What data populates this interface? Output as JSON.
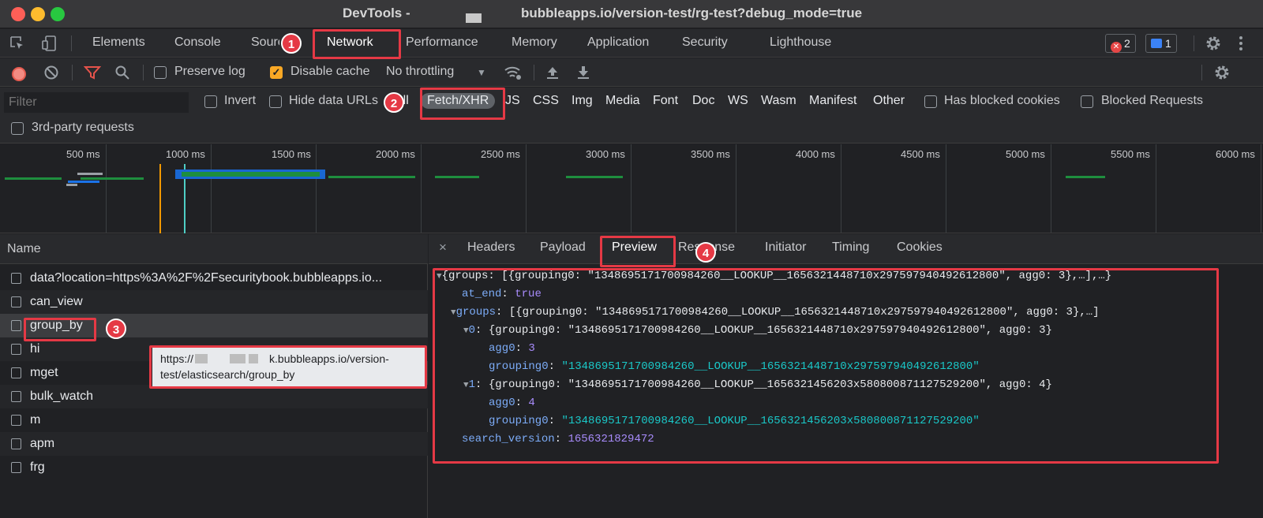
{
  "window": {
    "title_left": "DevTools -",
    "title_right": "bubbleapps.io/version-test/rg-test?debug_mode=true"
  },
  "main_tabs": [
    "Elements",
    "Console",
    "Sources",
    "Network",
    "Performance",
    "Memory",
    "Application",
    "Security",
    "Lighthouse"
  ],
  "status": {
    "errors": "2",
    "messages": "1"
  },
  "toolbar": {
    "preserve_log": "Preserve log",
    "disable_cache": "Disable cache",
    "throttling": "No throttling"
  },
  "filterbar": {
    "filter_placeholder": "Filter",
    "invert": "Invert",
    "hide_data_urls": "Hide data URLs",
    "all": "All",
    "types": [
      "Fetch/XHR",
      "JS",
      "CSS",
      "Img",
      "Media",
      "Font",
      "Doc",
      "WS",
      "Wasm",
      "Manifest",
      "Other"
    ],
    "has_blocked_cookies": "Has blocked cookies",
    "blocked_requests": "Blocked Requests",
    "third_party": "3rd-party requests"
  },
  "overview_ticks": [
    "500 ms",
    "1000 ms",
    "1500 ms",
    "2000 ms",
    "2500 ms",
    "3000 ms",
    "3500 ms",
    "4000 ms",
    "4500 ms",
    "5000 ms",
    "5500 ms",
    "6000 ms"
  ],
  "requests": {
    "header": "Name",
    "items": [
      "data?location=https%3A%2F%2Fsecuritybook.bubbleapps.io...",
      "can_view",
      "group_by",
      "hi",
      "mget",
      "bulk_watch",
      "m",
      "apm",
      "frg"
    ]
  },
  "tooltip": {
    "line1_prefix": "https://",
    "line1_suffix": "k.bubbleapps.io/version-",
    "line2": "test/elasticsearch/group_by"
  },
  "detail_tabs": [
    "Headers",
    "Payload",
    "Preview",
    "Response",
    "Initiator",
    "Timing",
    "Cookies"
  ],
  "preview": {
    "root_summary": "{groups: [{grouping0: \"1348695171700984260__LOOKUP__1656321448710x297597940492612800\", agg0: 3},…],…}",
    "at_end_key": "at_end",
    "at_end_val": "true",
    "groups_key": "groups",
    "groups_summary": "[{grouping0: \"1348695171700984260__LOOKUP__1656321448710x297597940492612800\", agg0: 3},…]",
    "item0_key": "0",
    "item0_summary": "{grouping0: \"1348695171700984260__LOOKUP__1656321448710x297597940492612800\", agg0: 3}",
    "item0_agg_key": "agg0",
    "item0_agg_val": "3",
    "item0_grp_key": "grouping0",
    "item0_grp_val": "\"1348695171700984260__LOOKUP__1656321448710x297597940492612800\"",
    "item1_key": "1",
    "item1_summary": "{grouping0: \"1348695171700984260__LOOKUP__1656321456203x580800871127529200\", agg0: 4}",
    "item1_agg_key": "agg0",
    "item1_agg_val": "4",
    "item1_grp_key": "grouping0",
    "item1_grp_val": "\"1348695171700984260__LOOKUP__1656321456203x580800871127529200\"",
    "sv_key": "search_version",
    "sv_val": "1656321829472"
  },
  "callouts": [
    "1",
    "2",
    "3",
    "4"
  ],
  "colors": {
    "highlight": "#e53945",
    "string": "#1ac8c8",
    "key": "#7cacf8",
    "number": "#a78bfa"
  }
}
